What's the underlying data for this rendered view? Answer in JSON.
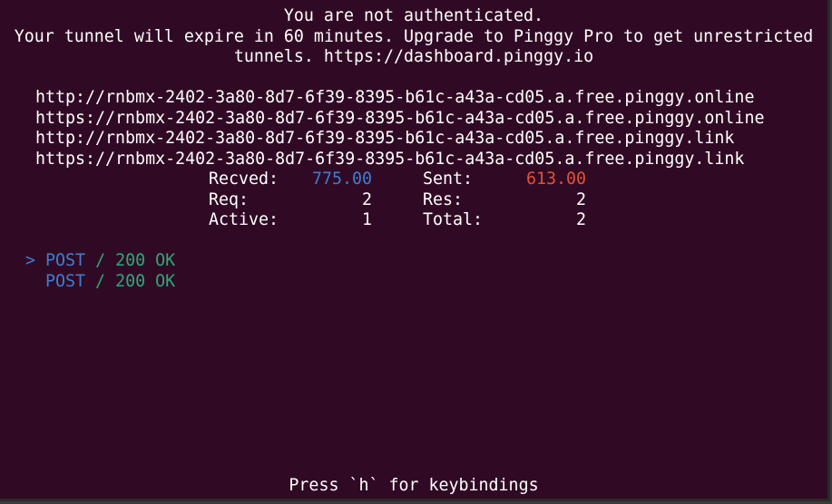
{
  "colors": {
    "terminal_background": "#300a24",
    "text": "#ffffff",
    "blue": "#3f7dd1",
    "red": "#e2503b",
    "green": "#30a67b"
  },
  "banner": {
    "line1": "You are not authenticated.",
    "line2": "Your tunnel will expire in 60 minutes. Upgrade to Pinggy Pro to get unrestricted",
    "line3": "tunnels. https://dashboard.pinggy.io"
  },
  "urls": [
    "http://rnbmx-2402-3a80-8d7-6f39-8395-b61c-a43a-cd05.a.free.pinggy.online",
    "https://rnbmx-2402-3a80-8d7-6f39-8395-b61c-a43a-cd05.a.free.pinggy.online",
    "http://rnbmx-2402-3a80-8d7-6f39-8395-b61c-a43a-cd05.a.free.pinggy.link",
    "https://rnbmx-2402-3a80-8d7-6f39-8395-b61c-a43a-cd05.a.free.pinggy.link"
  ],
  "stats": {
    "recved_label": "Recved:",
    "recved_value": "775.00",
    "sent_label": "Sent:",
    "sent_value": "613.00",
    "req_label": "Req:",
    "req_value": "2",
    "res_label": "Res:",
    "res_value": "2",
    "active_label": "Active:",
    "active_value": "1",
    "total_label": "Total:",
    "total_value": "2"
  },
  "requests": [
    {
      "selector": ">",
      "method": "POST",
      "separator": "/",
      "status": "200 OK"
    },
    {
      "selector": "",
      "method": "POST",
      "separator": "/",
      "status": "200 OK"
    }
  ],
  "footer": {
    "hint": "Press `h` for keybindings"
  }
}
